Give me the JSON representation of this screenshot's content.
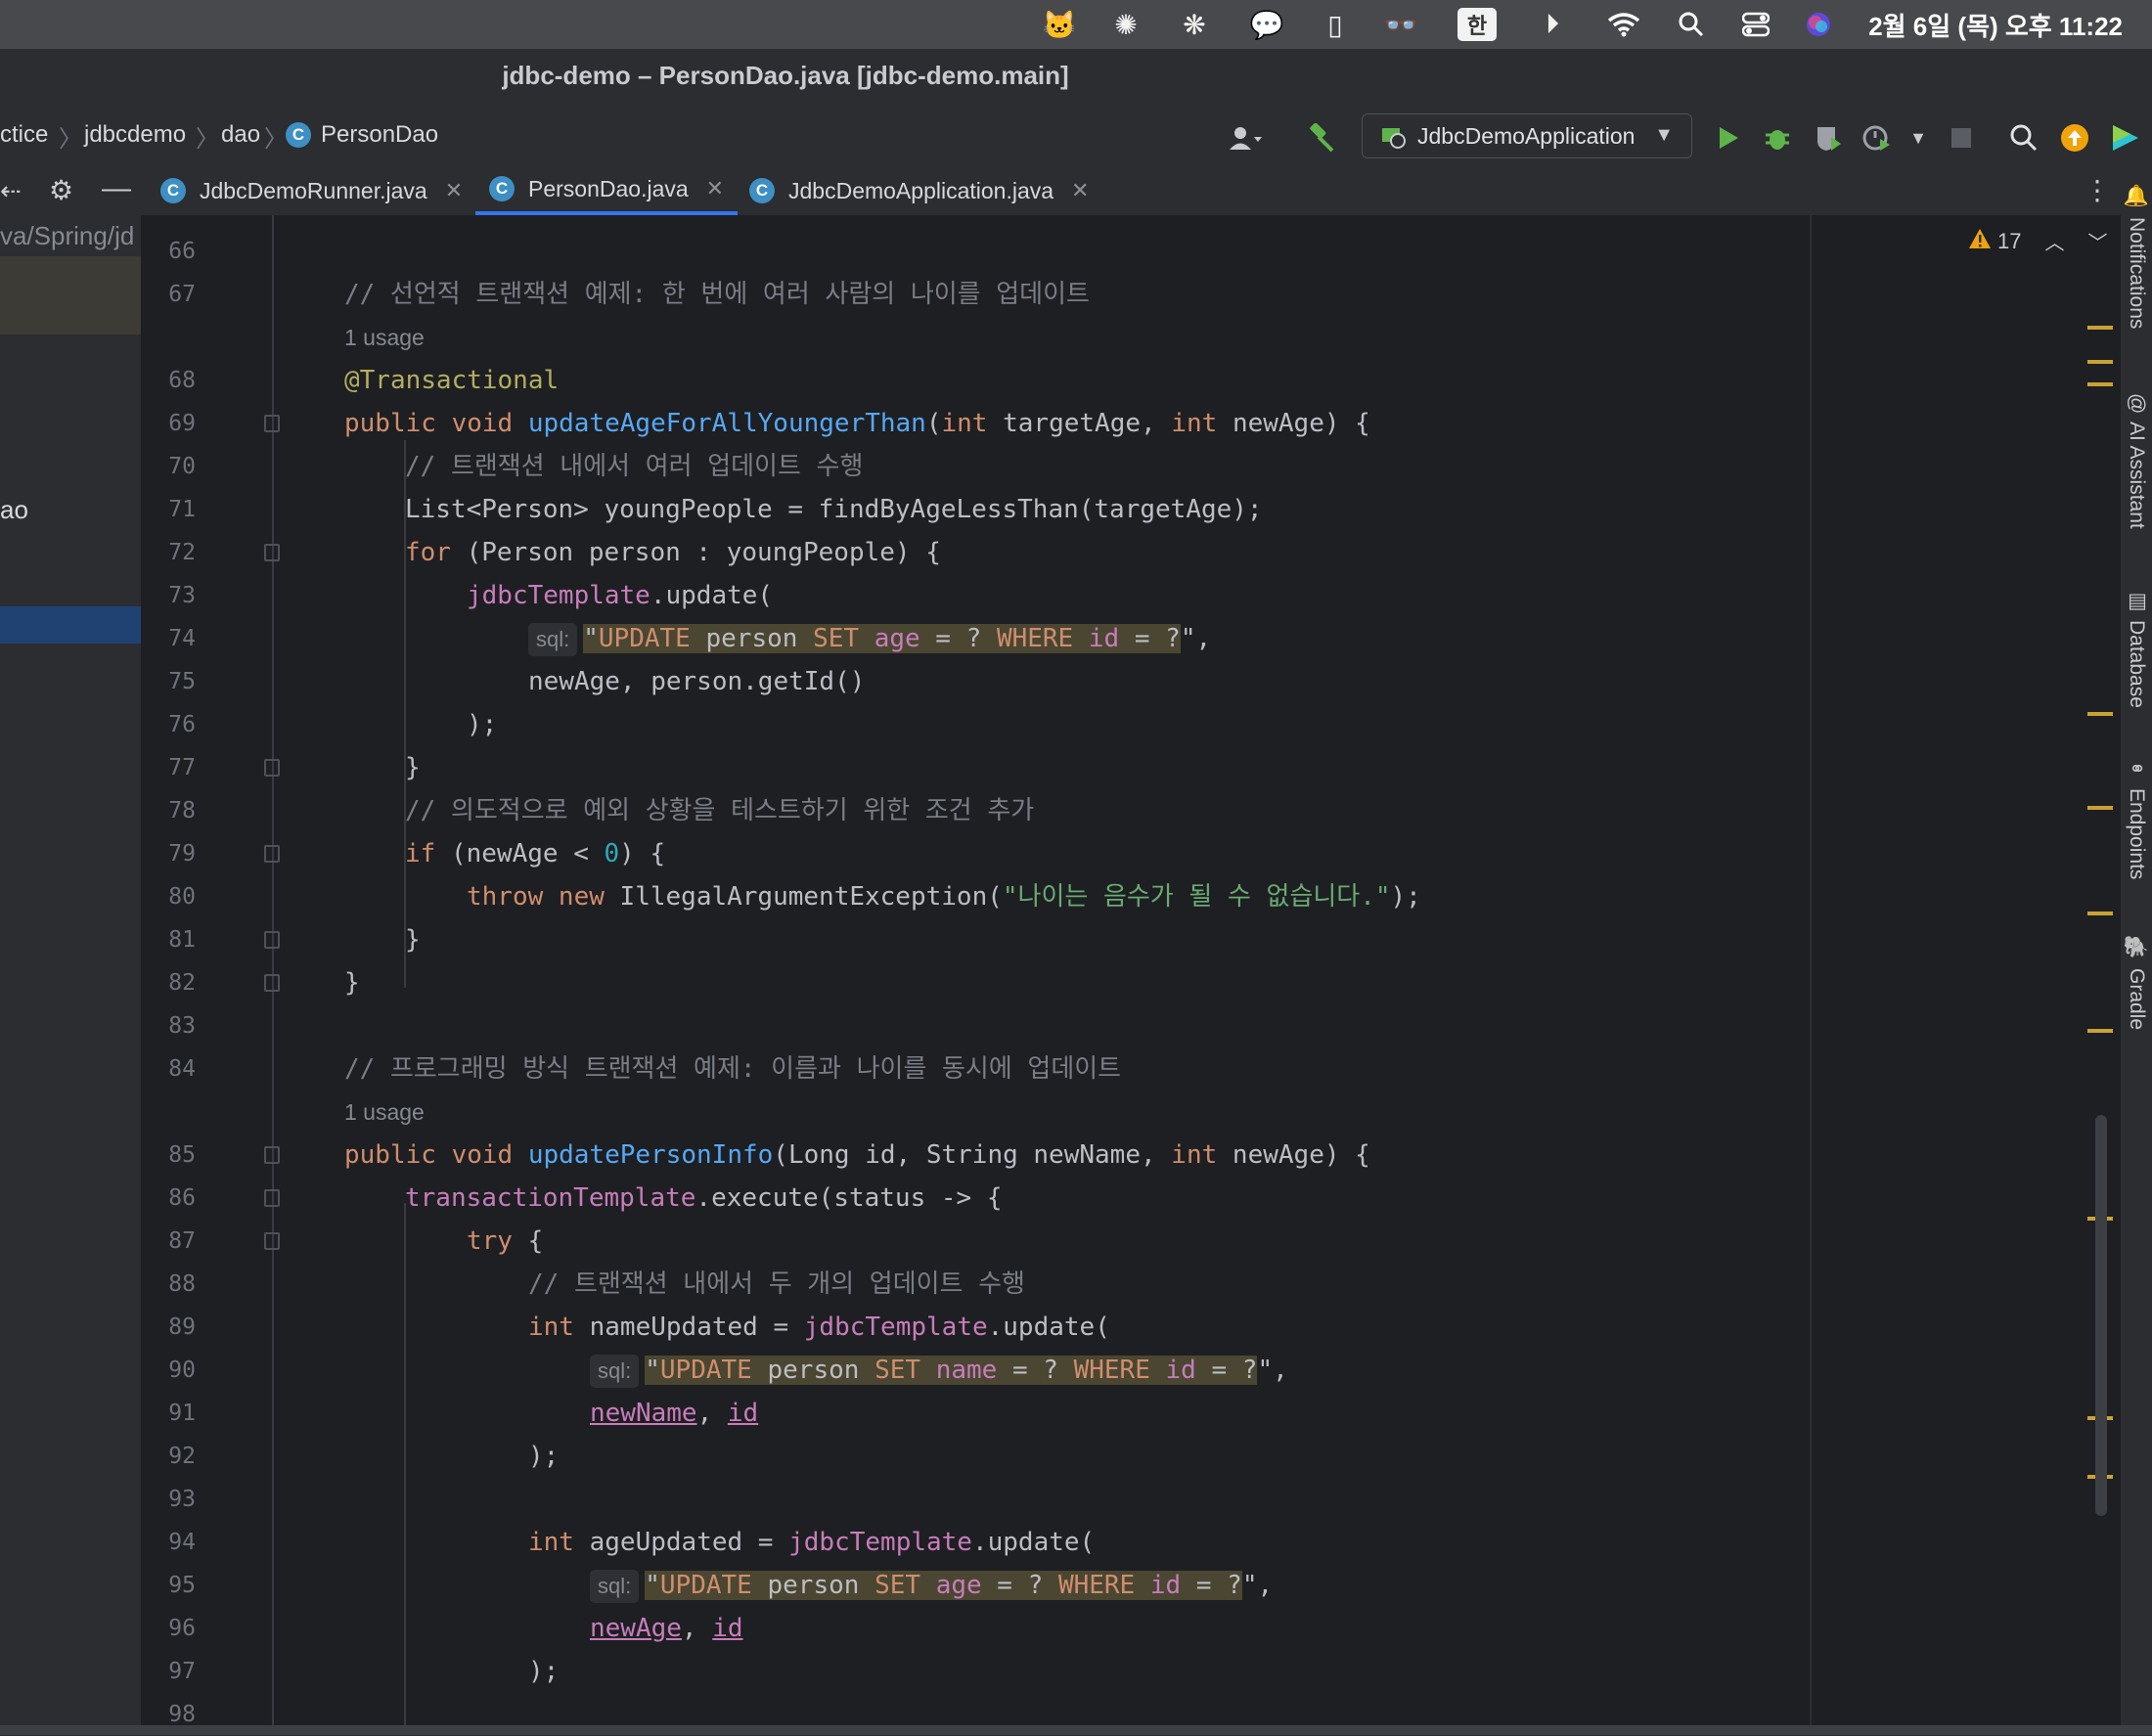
{
  "menubar": {
    "clock": "2월 6일 (목) 오후 11:22",
    "input_source": "한",
    "icons": [
      "app-icon",
      "openai-icon",
      "perplexity-icon",
      "messages-icon",
      "note-icon",
      "glasses-icon",
      "input-source-icon",
      "play-icon",
      "wifi-icon",
      "spotlight-icon",
      "control-center-icon",
      "siri-icon"
    ]
  },
  "window": {
    "title": "jdbc-demo – PersonDao.java [jdbc-demo.main]"
  },
  "breadcrumb": [
    "ctice",
    "jdbcdemo",
    "dao",
    "PersonDao"
  ],
  "toolbar": {
    "run_config": "JdbcDemoApplication"
  },
  "tabs": [
    {
      "label": "JdbcDemoRunner.java",
      "active": false
    },
    {
      "label": "PersonDao.java",
      "active": true
    },
    {
      "label": "JdbcDemoApplication.java",
      "active": false
    }
  ],
  "sidebar": {
    "path": "va/Spring/jd",
    "item": "ao"
  },
  "inspections": {
    "warnings": "17"
  },
  "right_tools": [
    "Notifications",
    "AI Assistant",
    "Database",
    "Endpoints",
    "Gradle"
  ],
  "code": {
    "l66": "66",
    "l67": "67",
    "l68": "68",
    "l69": "69",
    "l70": "70",
    "l71": "71",
    "l72": "72",
    "l73": "73",
    "l74": "74",
    "l75": "75",
    "l76": "76",
    "l77": "77",
    "l78": "78",
    "l79": "79",
    "l80": "80",
    "l81": "81",
    "l82": "82",
    "l83": "83",
    "l84": "84",
    "l85": "85",
    "l86": "86",
    "l87": "87",
    "l88": "88",
    "l89": "89",
    "l90": "90",
    "l91": "91",
    "l92": "92",
    "l93": "93",
    "l94": "94",
    "l95": "95",
    "l96": "96",
    "l97": "97",
    "l98": "98",
    "usage": "1 usage",
    "sql_hint": "sql:",
    "c67": "// 선언적 트랜잭션 예제: 한 번에 여러 사람의 나이를 업데이트",
    "a68": "@Transactional",
    "c70": "// 트랜잭션 내에서 여러 업데이트 수행",
    "c78": "// 의도적으로 예외 상황을 테스트하기 위한 조건 추가",
    "s80": "\"나이는 음수가 될 수 없습니다.\"",
    "c84": "// 프로그래밍 방식 트랜잭션 예제: 이름과 나이를 동시에 업데이트",
    "c88": "// 트랜잭션 내에서 두 개의 업데이트 수행"
  }
}
